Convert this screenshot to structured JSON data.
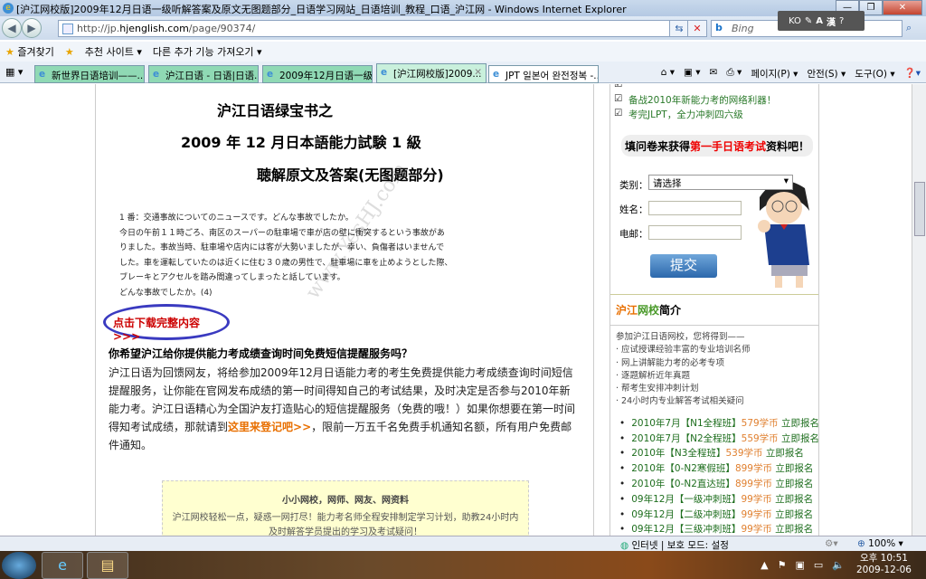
{
  "window": {
    "title": "[沪江网校版]2009年12月日语一级听解答案及原文无图题部分_日语学习网站_日语培训_教程_口语_沪江网 - Windows Internet Explorer"
  },
  "address": {
    "url_prefix": "http://jp.",
    "url_domain": "hjenglish.com",
    "url_path": "/page/90374/",
    "search_placeholder": "Bing"
  },
  "ime": {
    "lang": "KO",
    "a": "A",
    "kanji": "漢"
  },
  "favorites": {
    "label": "즐겨찾기",
    "suggested": "추천 사이트 ▾",
    "addons": "다른 추가 기능 가져오기 ▾"
  },
  "tabs": [
    "新世界日语培训——...",
    "沪江日语 - 日语|日语...",
    "2009年12月日语一级...",
    "[沪江网校版]2009...",
    "JPT 일본어 완전정복 -..."
  ],
  "commands": {
    "page": "페이지(P) ▾",
    "safety": "안전(S) ▾",
    "tools": "도구(O) ▾"
  },
  "article": {
    "title1": "沪江日语绿宝书之",
    "title2": "2009 年 12 月日本語能力試験 1 級",
    "title3": "聴解原文及答案(无图题部分)",
    "watermark": "www.YesHJ.com",
    "jp_lines": [
      "1 番：交通事故についてのニュースです。どんな事故でしたか。",
      "今日の午前１１時ごろ、南区のスーパーの駐車場で車が店の壁に衝突するという事故があ",
      "りました。事故当時、駐車場や店内には客が大勢いましたが、幸い、負傷者はいませんで",
      "した。車を運転していたのは近くに住む３０歳の男性で、駐車場に車を止めようとした際、",
      "ブレーキとアクセルを踏み間違ってしまったと話しています。",
      "どんな事故でしたか。(4)"
    ],
    "download": "点击下载完整内容>>>",
    "question": "你希望沪江给你提供能力考成绩查询时间免费短信提醒服务吗？",
    "para": "沪江日语为回馈网友，将给参加2009年12月日语能力考的考生免费提供能力考成绩查询时间短信提醒服务，让你能在官网发布成绩的第一时间得知自己的考试结果，及时决定是否参与2010年新能力考。沪江日语精心为全国沪友打造贴心的短信提醒服务（免费的哦！）如果你想要在第一时间得知考试成绩，那就请到",
    "para_link": "这里来登记吧>>",
    "para_end": "，限前一万五千名免费手机通知名额，所有用户免费邮件通知。",
    "box_title": "小小网校，网师、网友、网资料",
    "box_text": "沪江网校轻松一点，疑惑一网打尽！能力考名师全程安排制定学习计划，助教24小时内及时解答学员提出的学习及考试疑问！"
  },
  "sidebar": {
    "checks": [
      "备战2010年新能力考的网络利器！",
      "考完JLPT，全力冲刺四六级"
    ],
    "bubble_pre": "填问卷来获得",
    "bubble_red": "第一手日语考试",
    "bubble_post": "资料吧！",
    "category_label": "类别：",
    "category_value": "请选择",
    "name_label": "姓名：",
    "email_label": "电邮：",
    "submit": "提交",
    "intro_title_a": "沪江",
    "intro_title_b": "网校",
    "intro_title_c": "简介",
    "intro_lines": [
      "参加沪江日语网校，您将得到——",
      "· 应试授课经验丰富的专业培训名师",
      "· 网上讲解能力考的必考专项",
      "· 逐题解析近年真题",
      "· 帮考生安排冲刺计划",
      "· 24小时内专业解答考试相关疑问"
    ],
    "courses": [
      {
        "name": "2010年7月【N1全程班】",
        "price": "579学币",
        "action": "立即报名"
      },
      {
        "name": "2010年7月【N2全程班】",
        "price": "559学币",
        "action": "立即报名"
      },
      {
        "name": "2010年【N3全程班】",
        "price": "539学币",
        "action": "立即报名"
      },
      {
        "name": "2010年【0-N2寒假班】",
        "price": "899学币",
        "action": "立即报名"
      },
      {
        "name": "2010年【0-N2直达班】",
        "price": "899学币",
        "action": "立即报名"
      },
      {
        "name": "09年12月【一级冲刺班】",
        "price": "99学币",
        "action": "立即报名"
      },
      {
        "name": "09年12月【二级冲刺班】",
        "price": "99学币",
        "action": "立即报名"
      },
      {
        "name": "09年12月【三级冲刺班】",
        "price": "99学币",
        "action": "立即报名"
      }
    ]
  },
  "status": {
    "zone": "인터넷 | 보호 모드: 설정",
    "zoom": "100%"
  },
  "clock": {
    "period": "오후 10:51",
    "date": "2009-12-06"
  }
}
